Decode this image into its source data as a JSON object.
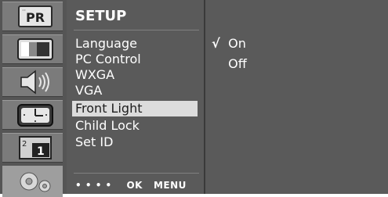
{
  "iconbar": {
    "icons": [
      {
        "name": "channel-pr-icon",
        "label": "PR"
      },
      {
        "name": "picture-icon"
      },
      {
        "name": "audio-speaker-icon"
      },
      {
        "name": "clock-time-icon"
      },
      {
        "name": "pip-icon",
        "label": "1"
      },
      {
        "name": "gear-setup-icon"
      }
    ]
  },
  "menu": {
    "title": "SETUP",
    "items": [
      "Language",
      "PC Control",
      "WXGA",
      "VGA",
      "Front Light",
      "Child Lock",
      "Set ID"
    ],
    "selected": "Front Light",
    "footer": {
      "dots": "•  •  •  •",
      "ok": "OK",
      "menu": "MENU"
    }
  },
  "options": {
    "items": [
      {
        "label": "On",
        "checked": true
      },
      {
        "label": "Off",
        "checked": false
      }
    ],
    "check_glyph": "√"
  }
}
